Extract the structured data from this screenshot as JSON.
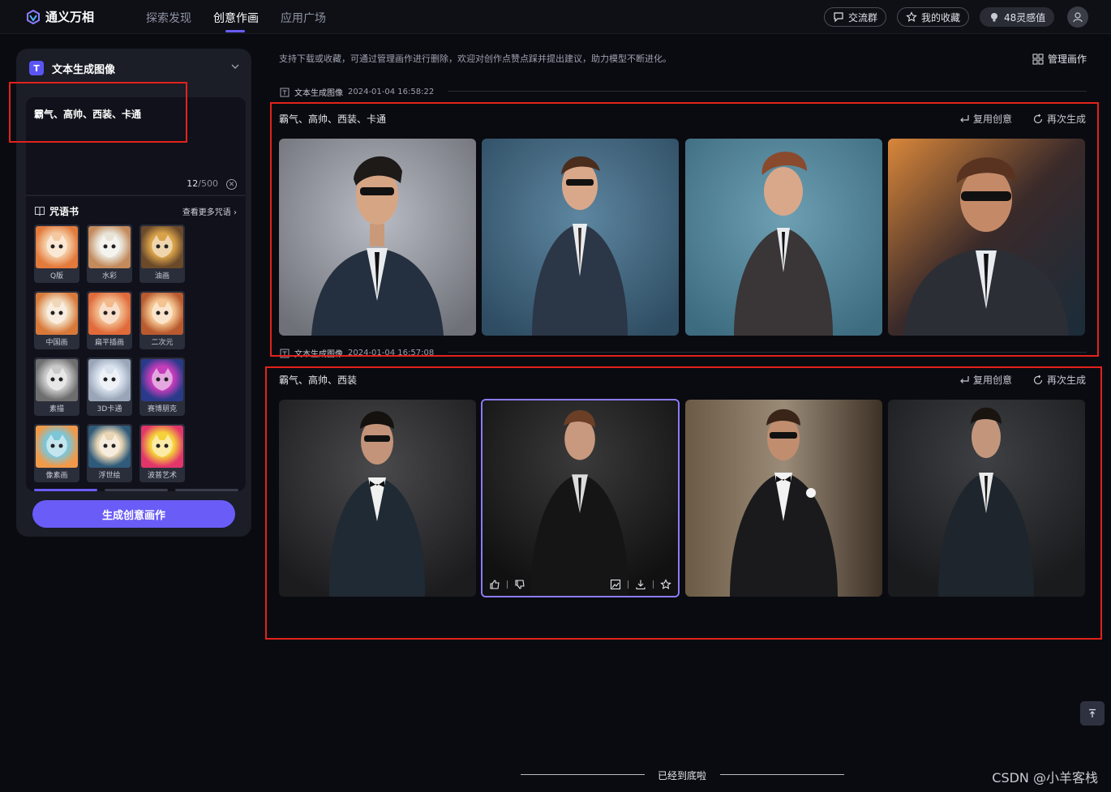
{
  "brand": {
    "name": "通义万相"
  },
  "nav": {
    "tabs": [
      {
        "label": "探索发现"
      },
      {
        "label": "创意作画"
      },
      {
        "label": "应用广场"
      }
    ]
  },
  "header_actions": {
    "group_chat": "交流群",
    "favorites": "我的收藏",
    "points": "48灵感值"
  },
  "panel": {
    "mode_title": "文本生成图像",
    "prompt_value": "霸气、高帅、西装、卡通",
    "char_count": "12",
    "char_limit": "/500",
    "library_title": "咒语书",
    "library_more": "查看更多咒语",
    "styles": [
      {
        "label": "Q版"
      },
      {
        "label": "水彩"
      },
      {
        "label": "油画"
      },
      {
        "label": "中国画"
      },
      {
        "label": "扁平插画"
      },
      {
        "label": "二次元"
      },
      {
        "label": "素描"
      },
      {
        "label": "3D卡通"
      },
      {
        "label": "赛博朋克"
      },
      {
        "label": "像素画"
      },
      {
        "label": "浮世绘"
      },
      {
        "label": "波普艺术"
      }
    ],
    "generate_label": "生成创意画作"
  },
  "content": {
    "notice": "支持下载或收藏，可通过管理画作进行删除，欢迎对创作点赞点踩并提出建议，助力模型不断进化。",
    "manage_label": "管理画作",
    "groups": [
      {
        "type": "文本生成图像",
        "time": "2024-01-04 16:58:22",
        "prompt": "霸气、高帅、西装、卡通",
        "reuse": "复用创意",
        "regen": "再次生成"
      },
      {
        "type": "文本生成图像",
        "time": "2024-01-04 16:57:08",
        "prompt": "霸气、高帅、西装",
        "reuse": "复用创意",
        "regen": "再次生成"
      }
    ],
    "end_text": "已经到底啦"
  },
  "watermark": "CSDN @小羊客栈",
  "colors": {
    "accent": "#6a5cf7",
    "highlight": "#e3221c",
    "background": "#0a0b10"
  }
}
